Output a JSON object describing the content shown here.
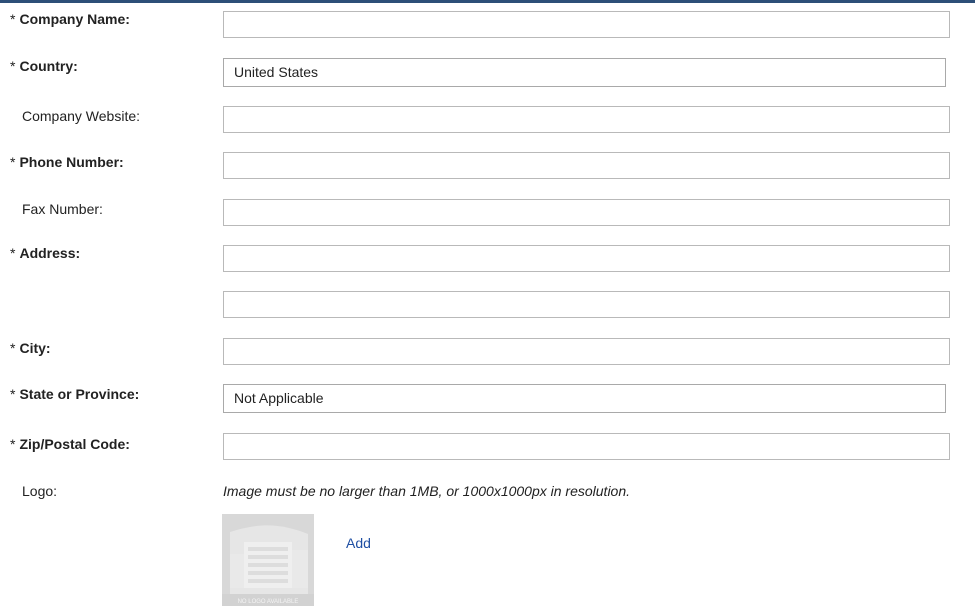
{
  "colors": {
    "top_bar": "#2d4f78",
    "link": "#1f4fa3",
    "field_border": "#b9b9b9"
  },
  "required_marker": "*",
  "fields": {
    "company_name": {
      "label": "Company Name:",
      "value": ""
    },
    "country": {
      "label": "Country:",
      "selected": "United States"
    },
    "company_website": {
      "label": "Company Website:",
      "value": ""
    },
    "phone_number": {
      "label": "Phone Number:",
      "value": ""
    },
    "fax_number": {
      "label": "Fax Number:",
      "value": ""
    },
    "address": {
      "label": "Address:",
      "line1": "",
      "line2": ""
    },
    "city": {
      "label": "City:",
      "value": ""
    },
    "state": {
      "label": "State or Province:",
      "selected": "Not Applicable"
    },
    "zip": {
      "label": "Zip/Postal Code:",
      "value": ""
    }
  },
  "logo": {
    "label": "Logo:",
    "note": "Image must be no larger than 1MB, or 1000x1000px in resolution.",
    "placeholder_text": "NO LOGO AVAILABLE",
    "add_link": "Add",
    "icon": "building-placeholder-icon"
  }
}
